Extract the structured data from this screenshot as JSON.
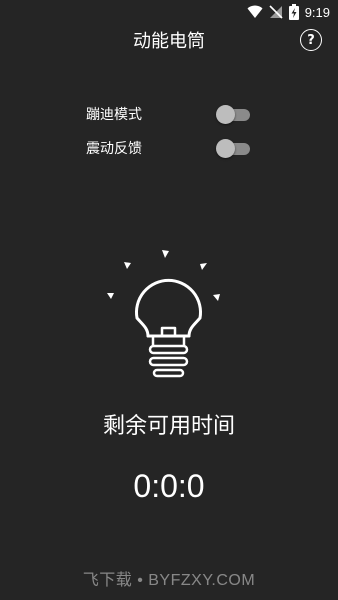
{
  "status_bar": {
    "time": "9:19",
    "icons": [
      "wifi-icon",
      "signal-off-icon",
      "battery-charging-icon"
    ]
  },
  "app": {
    "title": "动能电筒",
    "help_icon": "help-icon",
    "help_label": "?"
  },
  "settings": [
    {
      "label": "蹦迪模式",
      "enabled": false
    },
    {
      "label": "震动反馈",
      "enabled": false
    }
  ],
  "flashlight": {
    "icon": "lightbulb-icon"
  },
  "remaining": {
    "label": "剩余可用时间",
    "value": "0:0:0"
  },
  "watermark": "飞下载 • BYFZXY.COM",
  "colors": {
    "background": "#252525",
    "text": "#ffffff",
    "toggle_track_off": "#8a8a8a",
    "toggle_thumb_off": "#bdbdbd"
  }
}
